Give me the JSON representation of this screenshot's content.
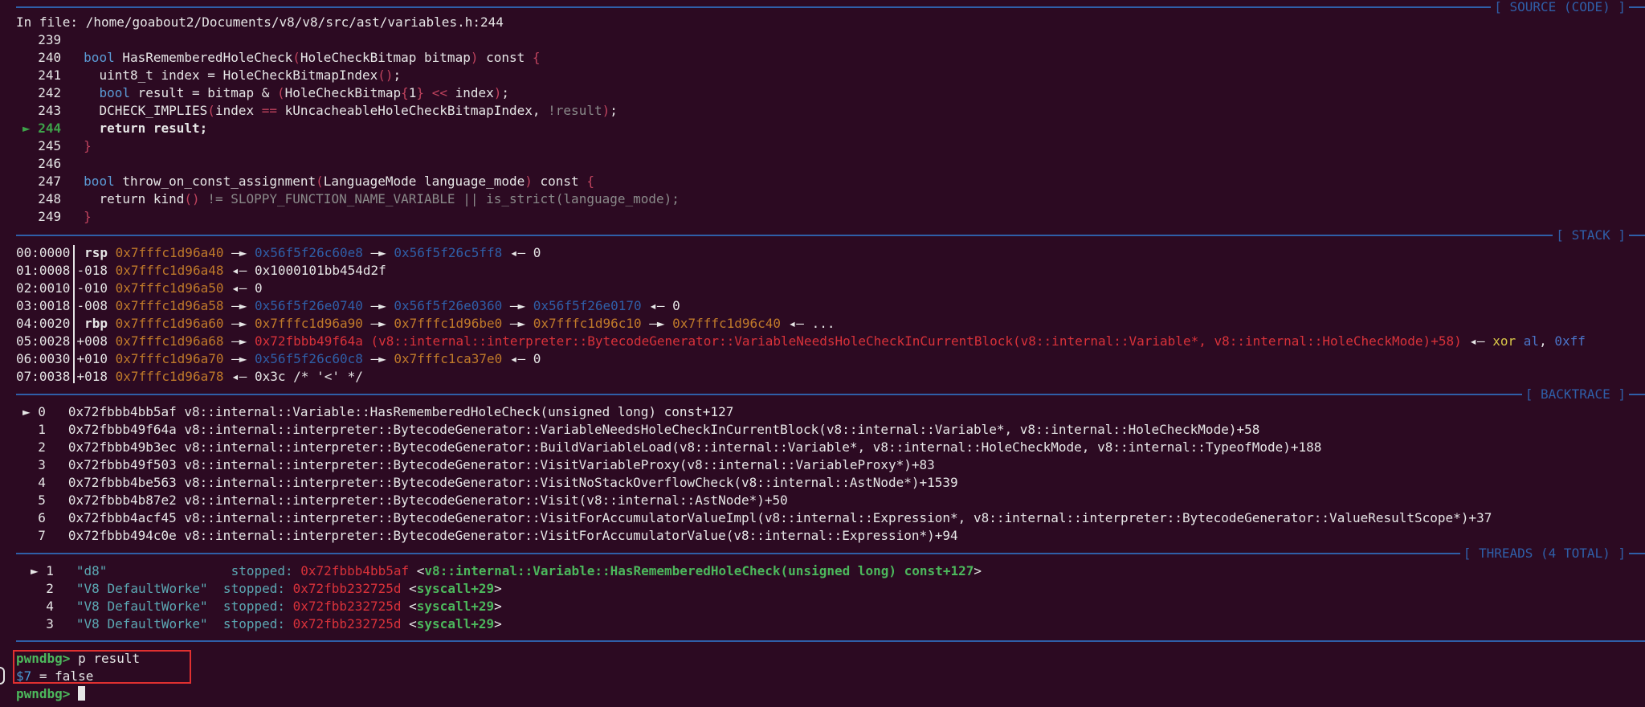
{
  "source": {
    "file_line": "In file: /home/goabout2/Documents/v8/v8/src/ast/variables.h:244",
    "header": "[ SOURCE (CODE) ]",
    "lines": [
      {
        "num": "239",
        "html": ""
      },
      {
        "num": "240",
        "html": "<span class='kw'>bool</span> HasRememberedHoleCheck<span class='paren'>(</span>HoleCheckBitmap bitmap<span class='paren'>)</span> const <span class='paren'>{</span>"
      },
      {
        "num": "241",
        "html": "  uint8_t index = HoleCheckBitmapIndex<span class='paren'>()</span>;"
      },
      {
        "num": "242",
        "html": "  <span class='kw'>bool</span> result = bitmap &amp; <span class='paren'>(</span>HoleCheckBitmap<span class='paren'>{</span>1<span class='paren'>}</span> <span class='paren'>&lt;&lt;</span> index<span class='paren'>)</span>;"
      },
      {
        "num": "243",
        "html": "  DCHECK_IMPLIES<span class='paren'>(</span>index <span class='paren'>==</span> kUncacheableHoleCheckBitmapIndex, <span class='dim'>!result</span><span class='paren'>)</span>;"
      },
      {
        "num": "244",
        "html": "  <span class='bold'>return result;</span>",
        "current": true
      },
      {
        "num": "245",
        "html": "<span class='paren'>}</span>"
      },
      {
        "num": "246",
        "html": ""
      },
      {
        "num": "247",
        "html": "<span class='kw'>bool</span> throw_on_const_assignment<span class='paren'>(</span>LanguageMode language_mode<span class='paren'>)</span> const <span class='paren'>{</span>"
      },
      {
        "num": "248",
        "html": "  return kind<span class='paren'>()</span> <span class='dim'>!= SLOPPY_FUNCTION_NAME_VARIABLE || is_strict(language_mode);</span>"
      },
      {
        "num": "249",
        "html": "<span class='paren'>}</span>"
      }
    ],
    "current_marker": "►"
  },
  "stack": {
    "header": "[ STACK ]",
    "rows": [
      {
        "idx": "00:0000",
        "off": " rsp",
        "html": "<span class='addr-stack'>0x7fffc1d96a40</span> —► <span class='addr-heap'>0x56f5f26c60e8</span> —► <span class='addr-heap'>0x56f5f26c5ff8</span> ◂— 0"
      },
      {
        "idx": "01:0008",
        "off": "-018",
        "html": "<span class='addr-stack'>0x7fffc1d96a48</span> ◂— 0x1000101bb454d2f"
      },
      {
        "idx": "02:0010",
        "off": "-010",
        "html": "<span class='addr-stack'>0x7fffc1d96a50</span> ◂— 0"
      },
      {
        "idx": "03:0018",
        "off": "-008",
        "html": "<span class='addr-stack'>0x7fffc1d96a58</span> —► <span class='addr-heap'>0x56f5f26e0740</span> —► <span class='addr-heap'>0x56f5f26e0360</span> —► <span class='addr-heap'>0x56f5f26e0170</span> ◂— 0"
      },
      {
        "idx": "04:0020",
        "off": " rbp",
        "html": "<span class='addr-stack'>0x7fffc1d96a60</span> —► <span class='addr-stack'>0x7fffc1d96a90</span> —► <span class='addr-stack'>0x7fffc1d96be0</span> —► <span class='addr-stack'>0x7fffc1d96c10</span> —► <span class='addr-stack'>0x7fffc1d96c40</span> ◂— ..."
      },
      {
        "idx": "05:0028",
        "off": "+008",
        "html": "<span class='addr-stack'>0x7fffc1d96a68</span> —► <span class='addr-code'>0x72fbbb49f64a (v8::internal::interpreter::BytecodeGenerator::VariableNeedsHoleCheckInCurrentBlock(v8::internal::Variable*, v8::internal::HoleCheckMode)+58)</span> ◂— <span class='yellow'>xor</span> <span class='blue'>al</span>, <span class='blue'>0xff</span>"
      },
      {
        "idx": "06:0030",
        "off": "+010",
        "html": "<span class='addr-stack'>0x7fffc1d96a70</span> —► <span class='addr-heap'>0x56f5f26c60c8</span> —► <span class='addr-stack'>0x7fffc1ca37e0</span> ◂— 0"
      },
      {
        "idx": "07:0038",
        "off": "+018",
        "html": "<span class='addr-stack'>0x7fffc1d96a78</span> ◂— 0x3c /* '&lt;' */"
      }
    ]
  },
  "backtrace": {
    "header": "[ BACKTRACE ]",
    "frames": [
      {
        "marker": "► 0",
        "addr": "0x72fbbb4bb5af",
        "sym": "v8::internal::Variable::HasRememberedHoleCheck(unsigned long) const+127"
      },
      {
        "marker": "  1",
        "addr": "0x72fbbb49f64a",
        "sym": "v8::internal::interpreter::BytecodeGenerator::VariableNeedsHoleCheckInCurrentBlock(v8::internal::Variable*, v8::internal::HoleCheckMode)+58"
      },
      {
        "marker": "  2",
        "addr": "0x72fbbb49b3ec",
        "sym": "v8::internal::interpreter::BytecodeGenerator::BuildVariableLoad(v8::internal::Variable*, v8::internal::HoleCheckMode, v8::internal::TypeofMode)+188"
      },
      {
        "marker": "  3",
        "addr": "0x72fbbb49f503",
        "sym": "v8::internal::interpreter::BytecodeGenerator::VisitVariableProxy(v8::internal::VariableProxy*)+83"
      },
      {
        "marker": "  4",
        "addr": "0x72fbbb4be563",
        "sym": "v8::internal::interpreter::BytecodeGenerator::VisitNoStackOverflowCheck(v8::internal::AstNode*)+1539"
      },
      {
        "marker": "  5",
        "addr": "0x72fbbb4b87e2",
        "sym": "v8::internal::interpreter::BytecodeGenerator::Visit(v8::internal::AstNode*)+50"
      },
      {
        "marker": "  6",
        "addr": "0x72fbbb4acf45",
        "sym": "v8::internal::interpreter::BytecodeGenerator::VisitForAccumulatorValueImpl(v8::internal::Expression*, v8::internal::interpreter::BytecodeGenerator::ValueResultScope*)+37"
      },
      {
        "marker": "  7",
        "addr": "0x72fbbb494c0e",
        "sym": "v8::internal::interpreter::BytecodeGenerator::VisitForAccumulatorValue(v8::internal::Expression*)+94"
      }
    ]
  },
  "threads": {
    "header": "[ THREADS (4 TOTAL) ]",
    "rows": [
      {
        "marker": "► 1",
        "name": "\"d8\"",
        "pad": "               ",
        "state": "stopped:",
        "addr": "0x72fbbb4bb5af",
        "func": "<v8::internal::Variable::HasRememberedHoleCheck(unsigned long) const+127>"
      },
      {
        "marker": "  2",
        "name": "\"V8 DefaultWorke\"",
        "pad": " ",
        "state": "stopped:",
        "addr": "0x72fbb232725d",
        "func": "<syscall+29>"
      },
      {
        "marker": "  4",
        "name": "\"V8 DefaultWorke\"",
        "pad": " ",
        "state": "stopped:",
        "addr": "0x72fbb232725d",
        "func": "<syscall+29>"
      },
      {
        "marker": "  3",
        "name": "\"V8 DefaultWorke\"",
        "pad": " ",
        "state": "stopped:",
        "addr": "0x72fbb232725d",
        "func": "<syscall+29>"
      }
    ]
  },
  "console": {
    "prompt": "pwndbg>",
    "command": " p result",
    "result_var": "$7",
    "result_rest": " = false",
    "prompt2": "pwndbg>"
  }
}
